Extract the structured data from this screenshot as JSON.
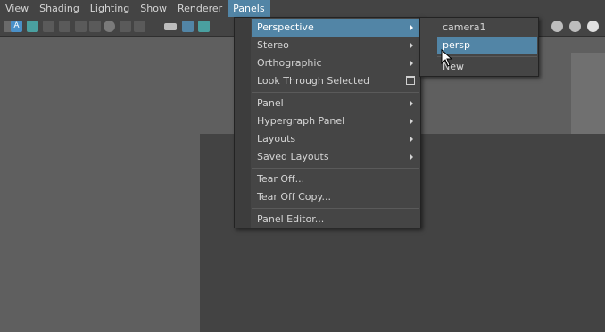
{
  "menubar": {
    "items": [
      "View",
      "Shading",
      "Lighting",
      "Show",
      "Renderer",
      "Panels"
    ],
    "active": "Panels"
  },
  "toolbar": {
    "icons": [
      "select-camera-icon",
      "camera-attributes-icon",
      "bookmark-icon",
      "image-plane-icon",
      "grid-icon",
      "film-gate-icon",
      "resolution-gate-icon",
      "gate-mask-icon",
      "field-chart-icon",
      "safe-action-icon",
      "camera-icon",
      "lock-camera-icon",
      "frame-icon",
      "sphere-shading-icon",
      "texture-icon",
      "light-icon"
    ]
  },
  "panels_menu": {
    "items": [
      {
        "label": "Perspective",
        "submenu": true,
        "highlighted": true
      },
      {
        "label": "Stereo",
        "submenu": true
      },
      {
        "label": "Orthographic",
        "submenu": true
      },
      {
        "label": "Look Through Selected",
        "option_box": true
      },
      {
        "label": "Panel",
        "submenu": true
      },
      {
        "label": "Hypergraph Panel",
        "submenu": true
      },
      {
        "label": "Layouts",
        "submenu": true
      },
      {
        "label": "Saved Layouts",
        "submenu": true
      },
      {
        "label": "Tear Off..."
      },
      {
        "label": "Tear Off Copy..."
      },
      {
        "label": "Panel Editor..."
      }
    ]
  },
  "perspective_submenu": {
    "items": [
      "camera1",
      "persp",
      "New"
    ],
    "highlighted": "persp"
  },
  "colors": {
    "highlight": "#5285a6",
    "menu_bg": "#454545",
    "viewport_bg": "#5f5f5f"
  }
}
